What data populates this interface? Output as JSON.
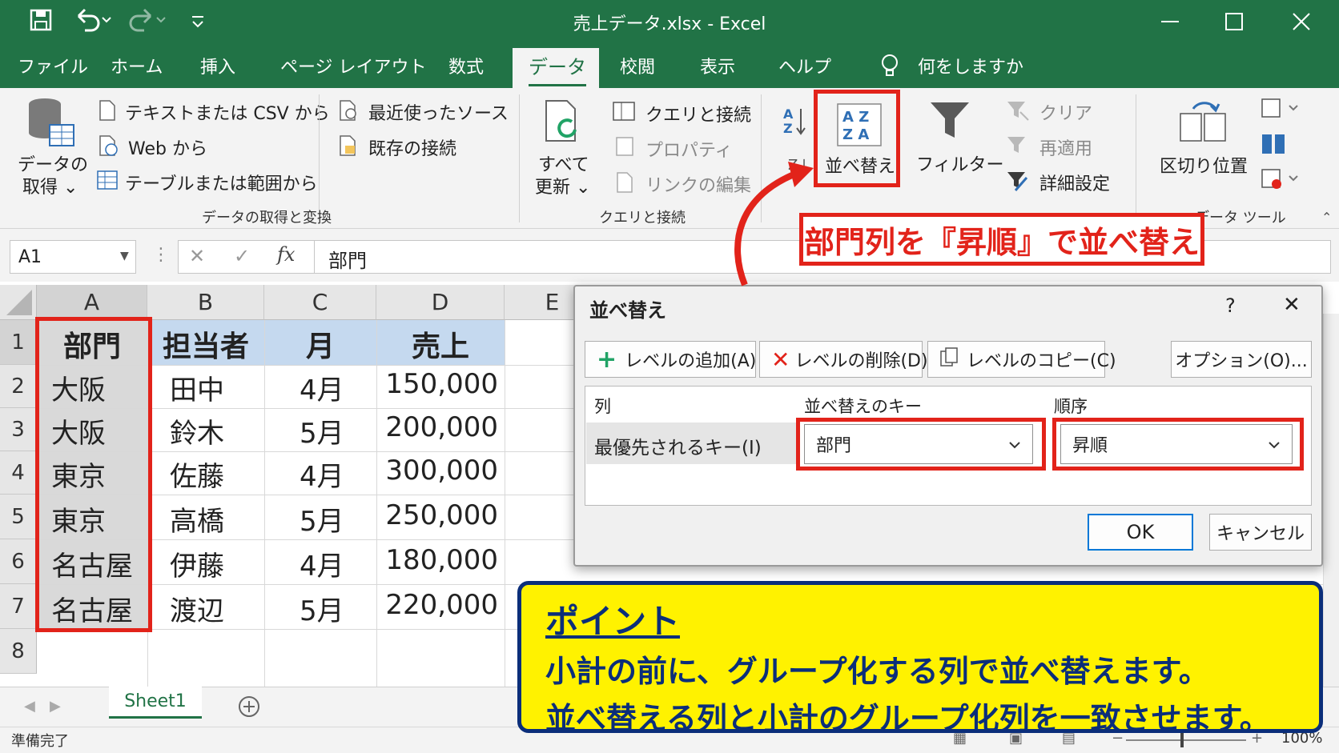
{
  "window": {
    "title": "売上データ.xlsx  -  Excel"
  },
  "tabs": [
    "ファイル",
    "ホーム",
    "挿入",
    "ページ レイアウト",
    "数式",
    "データ",
    "校閲",
    "表示",
    "ヘルプ"
  ],
  "tell_me": "何をしますか",
  "ribbon": {
    "get_data_label": "データの\n取得 ⌄",
    "get_data_line1": "データの",
    "get_data_line2": "取得 ⌄",
    "from_text_csv": "テキストまたは CSV から",
    "from_web": "Web から",
    "from_table": "テーブルまたは範囲から",
    "recent_sources": "最近使ったソース",
    "existing_connections": "既存の接続",
    "group_get_transform": "データの取得と変換",
    "refresh_all_line1": "すべて",
    "refresh_all_line2": "更新 ⌄",
    "queries_connections": "クエリと接続",
    "properties": "プロパティ",
    "edit_links": "リンクの編集",
    "group_queries": "クエリと接続",
    "sort_label": "並べ替え",
    "filter_label": "フィルター",
    "clear": "クリア",
    "reapply": "再適用",
    "advanced": "詳細設定",
    "text_to_columns": "区切り位置",
    "group_data_tools": "データ ツール"
  },
  "formula_bar": {
    "name_box": "A1",
    "fx": "fx",
    "content": "部門"
  },
  "columns": [
    "A",
    "B",
    "C",
    "D",
    "E"
  ],
  "rows": [
    "1",
    "2",
    "3",
    "4",
    "5",
    "6",
    "7",
    "8"
  ],
  "table": {
    "headers": [
      "部門",
      "担当者",
      "月",
      "売上"
    ],
    "data": [
      [
        "大阪",
        "田中",
        "4月",
        "150,000"
      ],
      [
        "大阪",
        "鈴木",
        "5月",
        "200,000"
      ],
      [
        "東京",
        "佐藤",
        "4月",
        "300,000"
      ],
      [
        "東京",
        "高橋",
        "5月",
        "250,000"
      ],
      [
        "名古屋",
        "伊藤",
        "4月",
        "180,000"
      ],
      [
        "名古屋",
        "渡辺",
        "5月",
        "220,000"
      ]
    ]
  },
  "sheet_tab": "Sheet1",
  "status": {
    "ready": "準備完了",
    "zoom": "100%"
  },
  "dialog": {
    "title": "並べ替え",
    "help": "?",
    "close": "✕",
    "add_level": "レベルの追加(A)",
    "delete_level": "レベルの削除(D)",
    "copy_level": "レベルのコピー(C)",
    "options": "オプション(O)...",
    "col_header": "列",
    "key_header": "並べ替えのキー",
    "order_header": "順序",
    "row_label": "最優先されるキー(I)",
    "key_value": "部門",
    "order_value": "昇順",
    "ok": "OK",
    "cancel": "キャンセル"
  },
  "callouts": {
    "sort_ascending": "部門列を『昇順』で並べ替え",
    "point_title": "ポイント",
    "point_line1": "小計の前に、グループ化する列で並べ替えます。",
    "point_line2": "並べ替える列と小計のグループ化列を一致させます。"
  },
  "colors": {
    "excel_green": "#217346",
    "highlight_red": "#e2231a",
    "callout_yellow": "#fff200",
    "callout_navy": "#0b2e7a",
    "header_fill": "#c5d9ef"
  }
}
